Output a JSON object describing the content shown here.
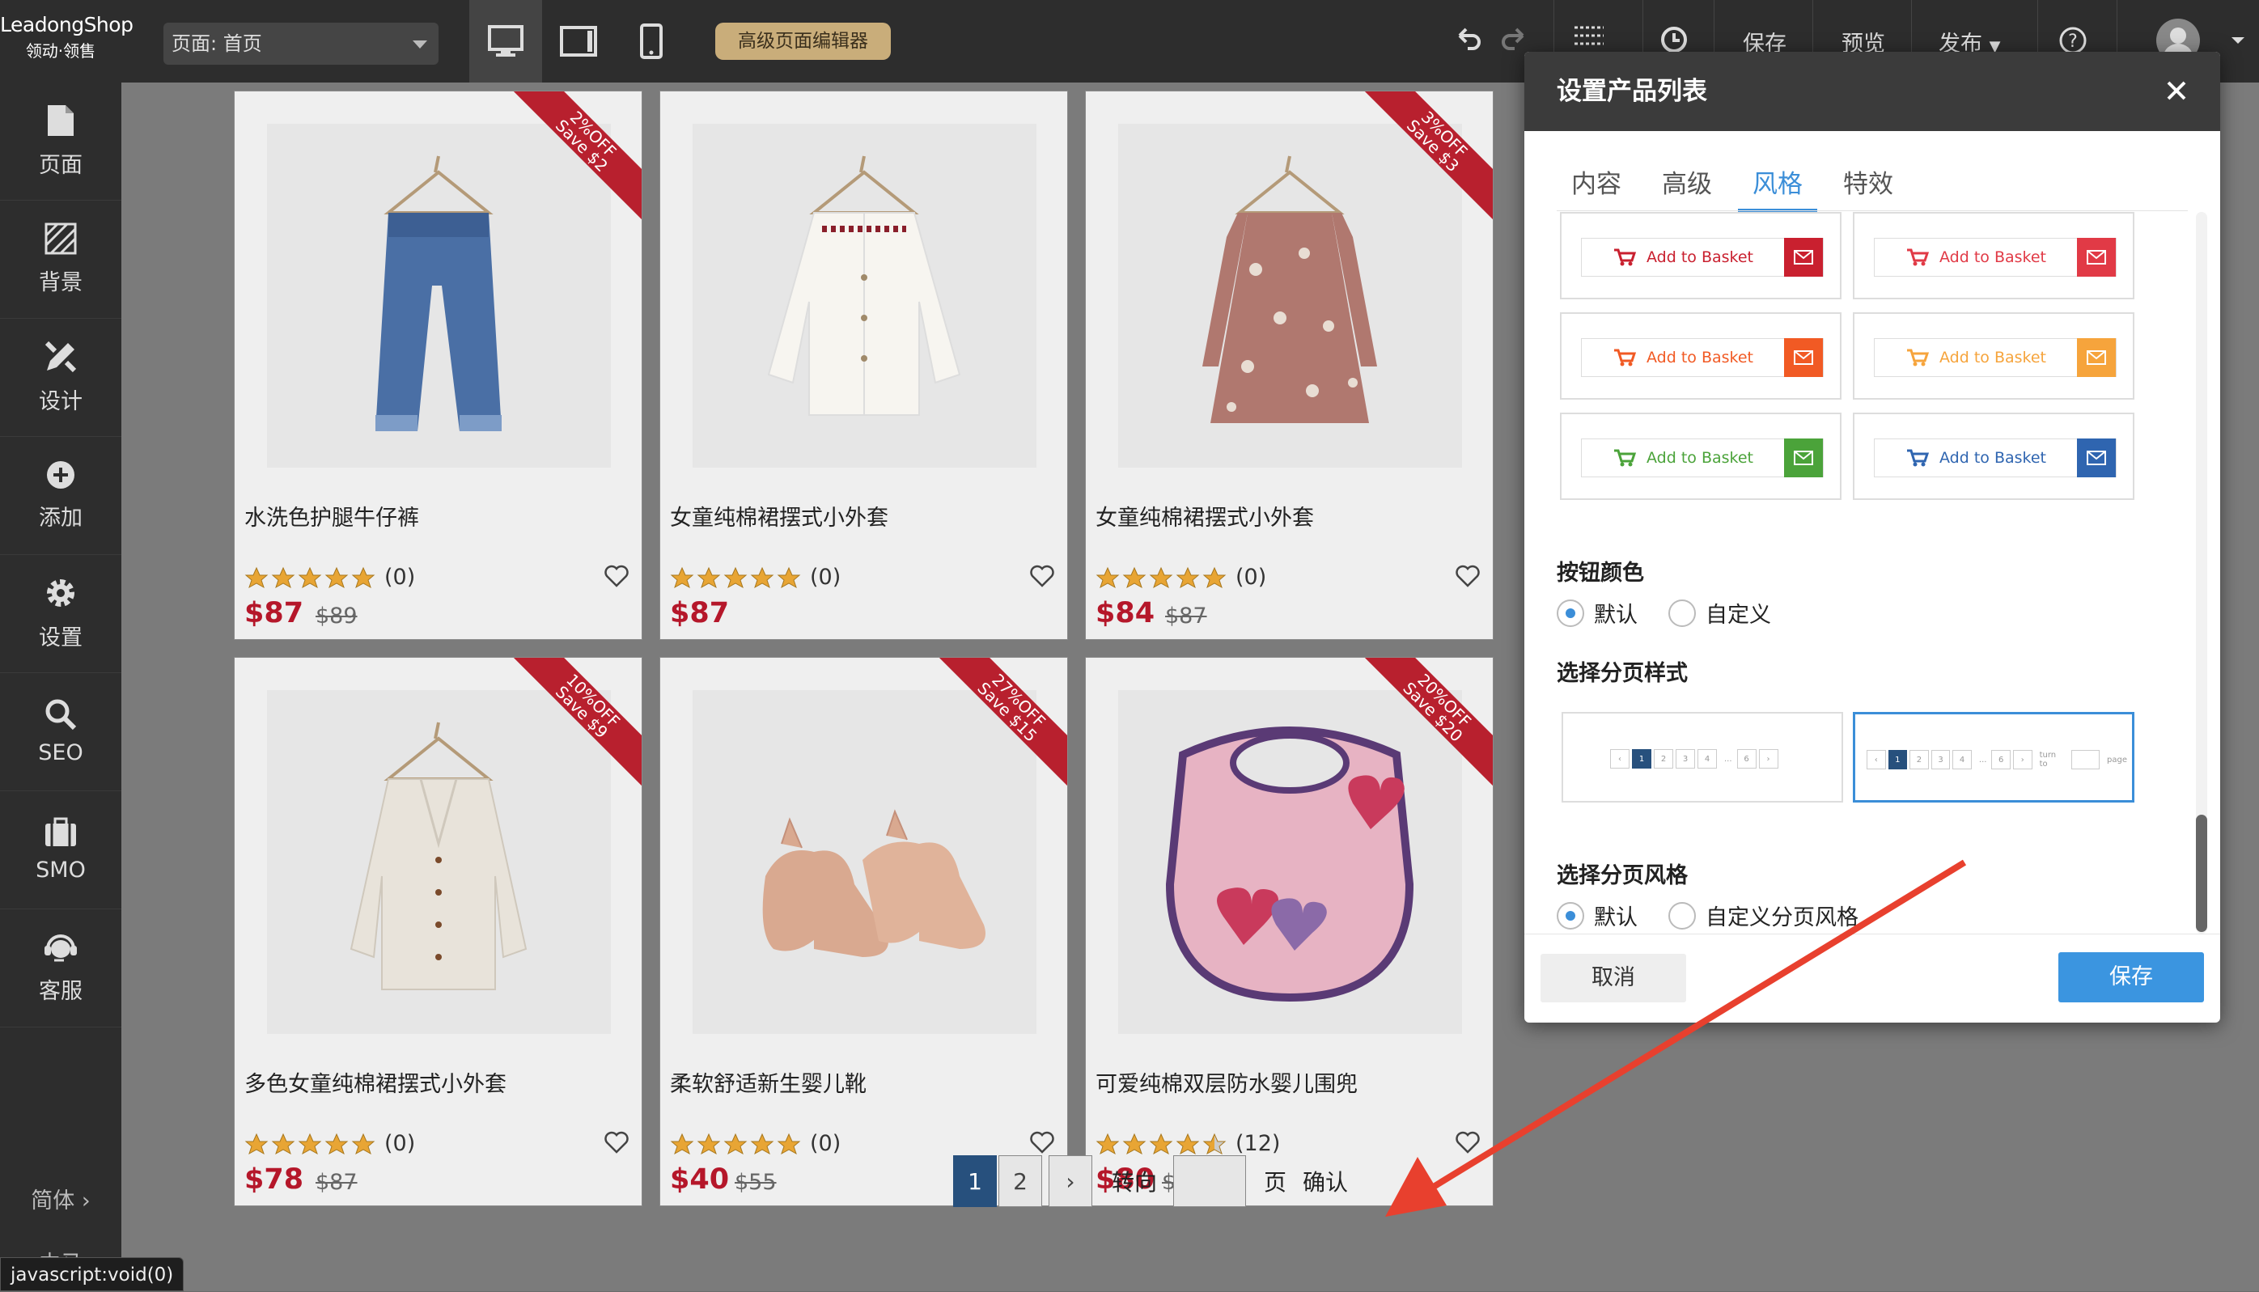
{
  "brand": {
    "line1": "LeadongShop",
    "line2": "领动·领售"
  },
  "topbar": {
    "page_select": "页面:  首页",
    "advanced_editor": "高级页面编辑器",
    "save": "保存",
    "preview": "预览",
    "publish": "发布"
  },
  "sidebar": {
    "items": [
      {
        "label": "页面",
        "icon": "page-icon"
      },
      {
        "label": "背景",
        "icon": "background-icon"
      },
      {
        "label": "设计",
        "icon": "design-icon"
      },
      {
        "label": "添加",
        "icon": "add-icon"
      },
      {
        "label": "设置",
        "icon": "gear-icon"
      },
      {
        "label": "SEO",
        "icon": "search-icon"
      },
      {
        "label": "SMO",
        "icon": "briefcase-icon"
      },
      {
        "label": "客服",
        "icon": "support-icon"
      }
    ],
    "language": "简体  ›",
    "language2": "中马"
  },
  "status_bar": "javascript:void(0)",
  "products": [
    {
      "name": "水洗色护腿牛仔裤",
      "ribbon1": "2%OFF",
      "ribbon2": "Save $2",
      "count": "(0)",
      "price": "$87",
      "old": "$89",
      "rating": 5
    },
    {
      "name": "女童纯棉裙摆式小外套",
      "ribbon1": "",
      "ribbon2": "",
      "count": "(0)",
      "price": "$87",
      "old": "",
      "rating": 5
    },
    {
      "name": "女童纯棉裙摆式小外套",
      "ribbon1": "3%OFF",
      "ribbon2": "Save $3",
      "count": "(0)",
      "price": "$84",
      "old": "$87",
      "rating": 5
    },
    {
      "name": "多色女童纯棉裙摆式小外套",
      "ribbon1": "10%OFF",
      "ribbon2": "Save $9",
      "count": "(0)",
      "price": "$78",
      "old": "$87",
      "rating": 5
    },
    {
      "name": "柔软舒适新生婴儿靴",
      "ribbon1": "27%OFF",
      "ribbon2": "Save $15",
      "count": "(0)",
      "price": "$40",
      "old": "$55",
      "rating": 5
    },
    {
      "name": "可爱纯棉双层防水婴儿围兜",
      "ribbon1": "20%OFF",
      "ribbon2": "Save $20",
      "count": "(12)",
      "price": "$80",
      "old": "$100",
      "rating": 4.5
    }
  ],
  "pagination": {
    "page1": "1",
    "page2": "2",
    "next": "›",
    "goto": "转向",
    "page_unit": "页",
    "confirm": "确认"
  },
  "modal": {
    "title": "设置产品列表",
    "tabs": [
      "内容",
      "高级",
      "风格",
      "特效"
    ],
    "active_tab": "风格",
    "button_label": "Add to Basket",
    "button_styles": [
      {
        "color": "#c9202f"
      },
      {
        "color": "#e13a46"
      },
      {
        "color": "#f15a24"
      },
      {
        "color": "#f6a43c"
      },
      {
        "color": "#4ba33a"
      },
      {
        "color": "#2f65b0"
      }
    ],
    "button_color_label": "按钮颜色",
    "button_color_options": [
      "默认",
      "自定义"
    ],
    "pager_style_label": "选择分页样式",
    "pager_style_turn_to": "turn to",
    "pager_style_page": "page",
    "pager_theme_label": "选择分页风格",
    "pager_theme_options": [
      "默认",
      "自定义分页风格"
    ],
    "cancel": "取消",
    "save": "保存"
  },
  "colors": {
    "accent": "#3b8ed8",
    "price": "#b5172a",
    "ribbon": "#b8202e",
    "annotation_arrow": "#e8402e"
  }
}
